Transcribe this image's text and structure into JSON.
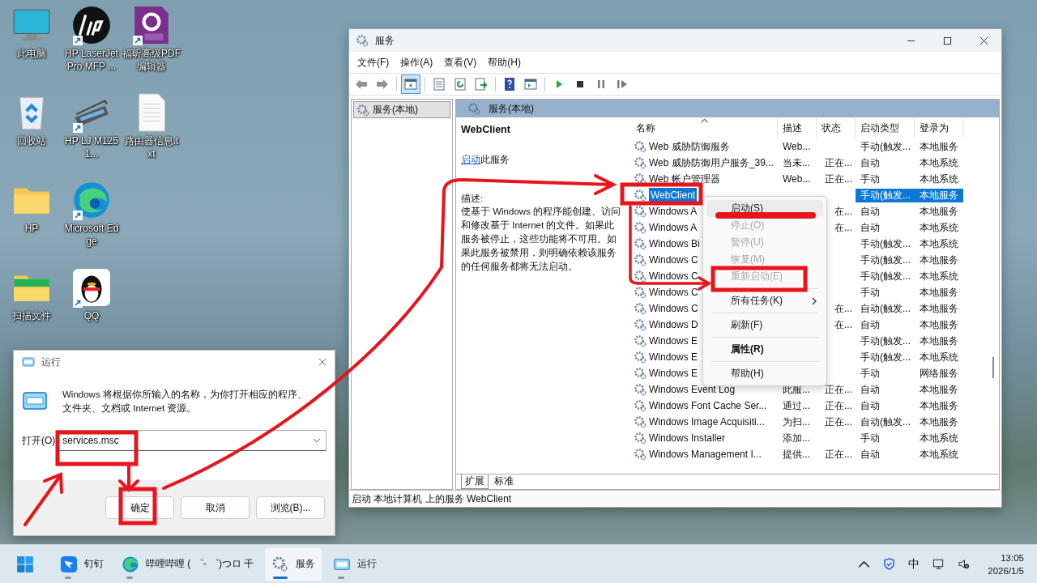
{
  "desktop_icons": [
    {
      "kind": "monitor",
      "label": "此电脑",
      "shortcut": false
    },
    {
      "kind": "recycle-bin",
      "label": "回收站",
      "shortcut": false
    },
    {
      "kind": "folder",
      "label": "HP",
      "shortcut": false
    },
    {
      "kind": "chat-folder",
      "label": "扫描文件",
      "shortcut": false
    },
    {
      "kind": "hp-logo",
      "label": "HP LaserJet Pro MFP ...",
      "shortcut": true
    },
    {
      "kind": "scanner",
      "label": "HP LJ M1251...",
      "shortcut": true
    },
    {
      "kind": "edge",
      "label": "Microsoft Edge",
      "shortcut": true
    },
    {
      "kind": "penguin",
      "label": "QQ",
      "shortcut": true
    },
    {
      "kind": "pdf",
      "label": "福昕高级PDF编辑器",
      "shortcut": true
    },
    {
      "kind": "text-file",
      "label": "路由器信息.txt",
      "shortcut": false
    }
  ],
  "services_window": {
    "title": "服务",
    "menu": [
      "文件(F)",
      "操作(A)",
      "查看(V)",
      "帮助(H)"
    ],
    "toolbar": [
      {
        "kind": "back",
        "selected": false
      },
      {
        "kind": "forward",
        "selected": false
      },
      {
        "kind": "separator"
      },
      {
        "kind": "tree",
        "selected": true
      },
      {
        "kind": "separator"
      },
      {
        "kind": "properties",
        "selected": false
      },
      {
        "kind": "refresh",
        "selected": false
      },
      {
        "kind": "export",
        "selected": false
      },
      {
        "kind": "separator"
      },
      {
        "kind": "help",
        "selected": false
      },
      {
        "kind": "console",
        "selected": false
      },
      {
        "kind": "separator"
      },
      {
        "kind": "play",
        "selected": false
      },
      {
        "kind": "stop",
        "selected": false
      },
      {
        "kind": "pause",
        "selected": false
      },
      {
        "kind": "restart",
        "selected": false
      }
    ],
    "tree": [
      {
        "label": "服务(本地)",
        "selected": true
      }
    ],
    "pane_title": "服务(本地)",
    "detail": {
      "name": "WebClient",
      "action_link": "启动",
      "action_text": "此服务",
      "description_label": "描述:",
      "description": "使基于 Windows 的程序能创建、访问和修改基于 Internet 的文件。如果此服务被停止，这些功能将不可用。如果此服务被禁用，则明确依赖该服务的任何服务都将无法启动。"
    },
    "columns": [
      "名称",
      "描述",
      "状态",
      "启动类型",
      "登录为"
    ],
    "rows": [
      {
        "name": "Web 威胁防御服务",
        "description": "Web...",
        "startup": "手动(触发...",
        "logon": "本地服务",
        "selected": false
      },
      {
        "name": "Web 威胁防御用户服务_39...",
        "description": "当未...",
        "status": "正在...",
        "startup": "自动",
        "logon": "本地系统",
        "selected": false
      },
      {
        "name": "Web 帐户管理器",
        "description": "Web...",
        "status": "正在...",
        "startup": "手动",
        "logon": "本地系统",
        "selected": false
      },
      {
        "name": "WebClient",
        "startup": "手动(触发...",
        "logon": "本地服务",
        "selected": true
      },
      {
        "name": "Windows A",
        "status": "在...",
        "startup": "自动",
        "logon": "本地服务",
        "selected": false
      },
      {
        "name": "Windows A",
        "status": "在...",
        "startup": "自动",
        "logon": "本地系统",
        "selected": false
      },
      {
        "name": "Windows Bi",
        "startup": "手动(触发...",
        "logon": "本地系统",
        "selected": false
      },
      {
        "name": "Windows C",
        "startup": "手动(触发...",
        "logon": "本地服务",
        "selected": false
      },
      {
        "name": "Windows C",
        "startup": "手动(触发...",
        "logon": "本地系统",
        "selected": false
      },
      {
        "name": "Windows C",
        "startup": "手动",
        "logon": "本地服务",
        "selected": false
      },
      {
        "name": "Windows C",
        "status": "在...",
        "startup": "自动(触发...",
        "logon": "本地服务",
        "selected": false
      },
      {
        "name": "Windows D",
        "status": "在...",
        "startup": "自动",
        "logon": "本地服务",
        "selected": false
      },
      {
        "name": "Windows E",
        "startup": "手动(触发...",
        "logon": "本地服务",
        "selected": false
      },
      {
        "name": "Windows E",
        "startup": "手动(触发...",
        "logon": "本地系统",
        "selected": false
      },
      {
        "name": "Windows E",
        "startup": "手动",
        "logon": "网络服务",
        "selected": false
      },
      {
        "name": "Windows Event Log",
        "description": "此服...",
        "status": "正在...",
        "startup": "自动",
        "logon": "本地服务",
        "selected": false
      },
      {
        "name": "Windows Font Cache Ser...",
        "description": "通过...",
        "status": "正在...",
        "startup": "自动",
        "logon": "本地服务",
        "selected": false
      },
      {
        "name": "Windows Image Acquisiti...",
        "description": "为扫...",
        "status": "正在...",
        "startup": "自动(触发...",
        "logon": "本地服务",
        "selected": false
      },
      {
        "name": "Windows Installer",
        "description": "添加...",
        "startup": "手动",
        "logon": "本地系统",
        "selected": false
      },
      {
        "name": "Windows Management I...",
        "description": "提供...",
        "status": "正在...",
        "startup": "自动",
        "logon": "本地系统",
        "selected": false
      }
    ],
    "tabs": [
      {
        "label": "扩展",
        "selected": true
      },
      {
        "label": "标准",
        "selected": false
      }
    ],
    "status_bar": "启动 本地计算机 上的服务 WebClient"
  },
  "context_menu": [
    {
      "kind": "item",
      "label": "启动(S)",
      "disabled": false,
      "highlighted": true,
      "default": false,
      "submenu": false
    },
    {
      "kind": "item",
      "label": "停止(O)",
      "disabled": true,
      "highlighted": false,
      "default": false,
      "submenu": false
    },
    {
      "kind": "item",
      "label": "暂停(U)",
      "disabled": true,
      "highlighted": false,
      "default": false,
      "submenu": false
    },
    {
      "kind": "item",
      "label": "恢复(M)",
      "disabled": true,
      "highlighted": false,
      "default": false,
      "submenu": false
    },
    {
      "kind": "item",
      "label": "重新启动(E)",
      "disabled": true,
      "highlighted": false,
      "default": false,
      "submenu": false
    },
    {
      "kind": "separator"
    },
    {
      "kind": "item",
      "label": "所有任务(K)",
      "disabled": false,
      "highlighted": false,
      "default": false,
      "submenu": true
    },
    {
      "kind": "separator"
    },
    {
      "kind": "item",
      "label": "刷新(F)",
      "disabled": false,
      "highlighted": false,
      "default": false,
      "submenu": false
    },
    {
      "kind": "separator"
    },
    {
      "kind": "item",
      "label": "属性(R)",
      "disabled": false,
      "highlighted": false,
      "default": true,
      "submenu": false
    },
    {
      "kind": "separator"
    },
    {
      "kind": "item",
      "label": "帮助(H)",
      "disabled": false,
      "highlighted": false,
      "default": false,
      "submenu": false
    }
  ],
  "run_dialog": {
    "title": "运行",
    "message": "Windows 将根据你所输入的名称，为你打开相应的程序、文件夹、文档或 Internet 资源。",
    "open_label": "打开(O)",
    "value": "services.msc",
    "buttons": [
      "确定",
      "取消",
      "浏览(B)..."
    ]
  },
  "taskbar": {
    "apps": [
      {
        "kind": "dingtalk",
        "label": "钉钉",
        "active": false
      },
      {
        "kind": "edge",
        "label": "哔哩哔哩 ( ゜- ゜)つロ 干",
        "active": false
      },
      {
        "kind": "gear",
        "label": "服务",
        "active": true
      },
      {
        "kind": "run",
        "label": "运行",
        "active": false
      }
    ],
    "ime": "中",
    "time": "13:05",
    "date": "2026/1/5"
  }
}
